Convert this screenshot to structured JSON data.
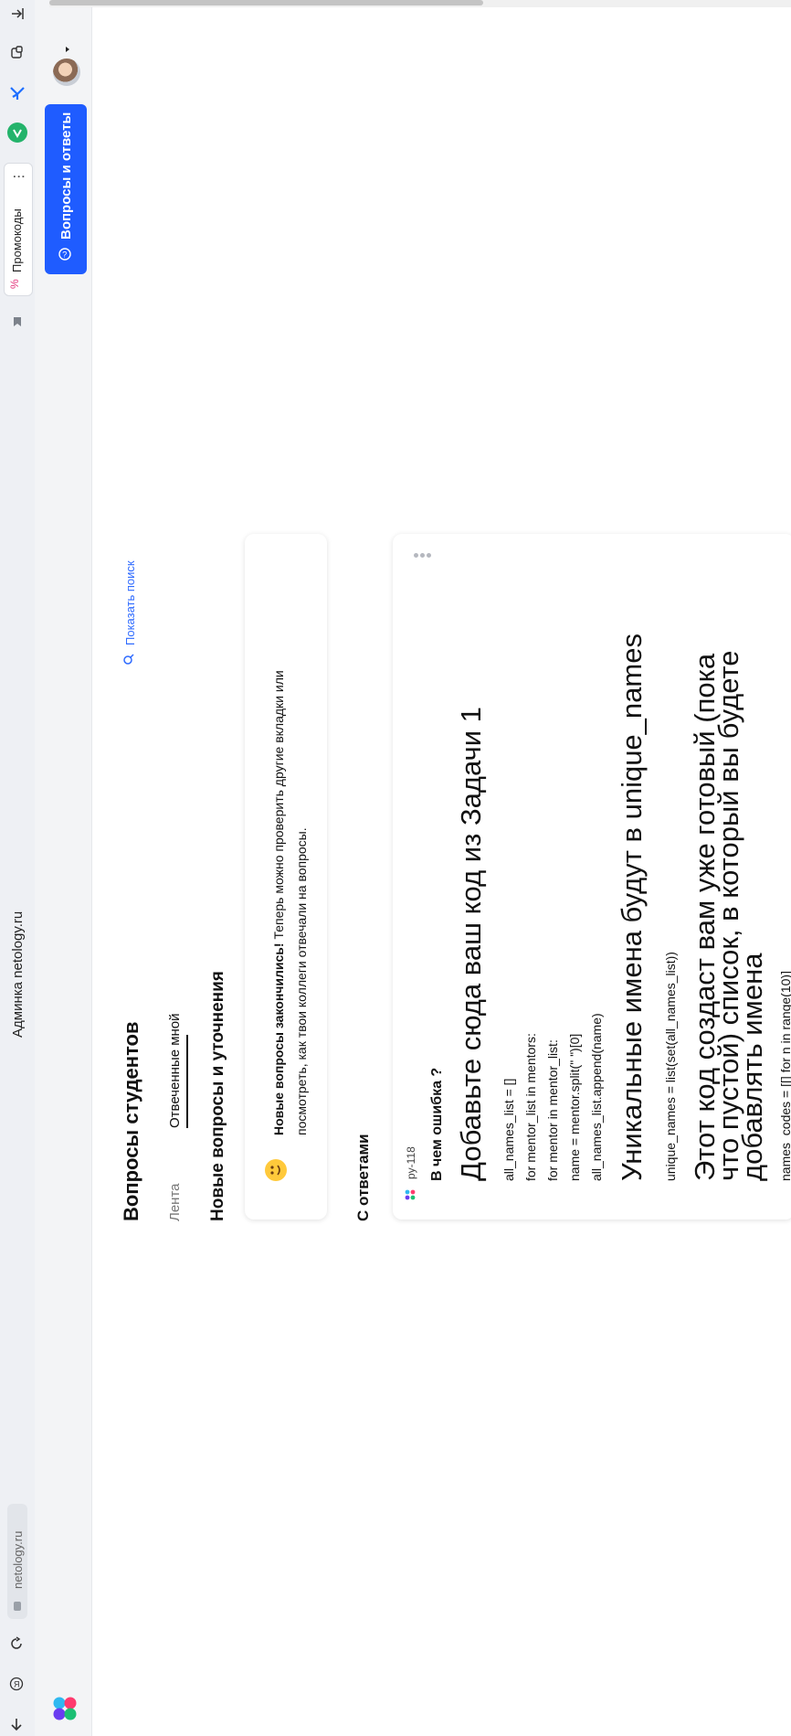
{
  "browser": {
    "site_title": "Админка netology.ru",
    "address": "netology.ru",
    "promo_label": "Промокоды",
    "more_glyph": "⋮"
  },
  "rail": {
    "qa_button_label": "Вопросы и ответы"
  },
  "page": {
    "title": "Вопросы студентов",
    "tabs": [
      {
        "label": "Лента",
        "active": false
      },
      {
        "label": "Отвеченные мной",
        "active": true
      }
    ],
    "section_new": "Новые вопросы и уточнения",
    "show_search": "Показать поиск",
    "notice": {
      "bold": "Новые вопросы закончились!",
      "line1_rest": " Теперь можно проверить другие вкладки или",
      "line2": "посмотреть, как твои коллеги отвечали на вопросы."
    },
    "section_answered": "С ответами"
  },
  "question": {
    "tag": "py-118",
    "label": "В чем ошибка ?",
    "heading1": "Добавьте сюда ваш код из Задачи 1",
    "code1": [
      "all_names_list = []",
      "for mentor_list in mentors:",
      "for mentor in mentor_list:",
      "name = mentor.split(\" \")[0]",
      "all_names_list.append(name)"
    ],
    "heading2": "Уникальные имена будут в unique_names",
    "code2": "unique_names = list(set(all_names_list))",
    "heading3_lines": [
      "Этот код создаст вам уже готовый (пока",
      "что пустой) список, в который вы будете",
      "добавлять имена"
    ],
    "code3": "names_codes = [[] for n in range(10)]"
  },
  "colors": {
    "accent": "#1f5cff",
    "link": "#2f6bff"
  }
}
